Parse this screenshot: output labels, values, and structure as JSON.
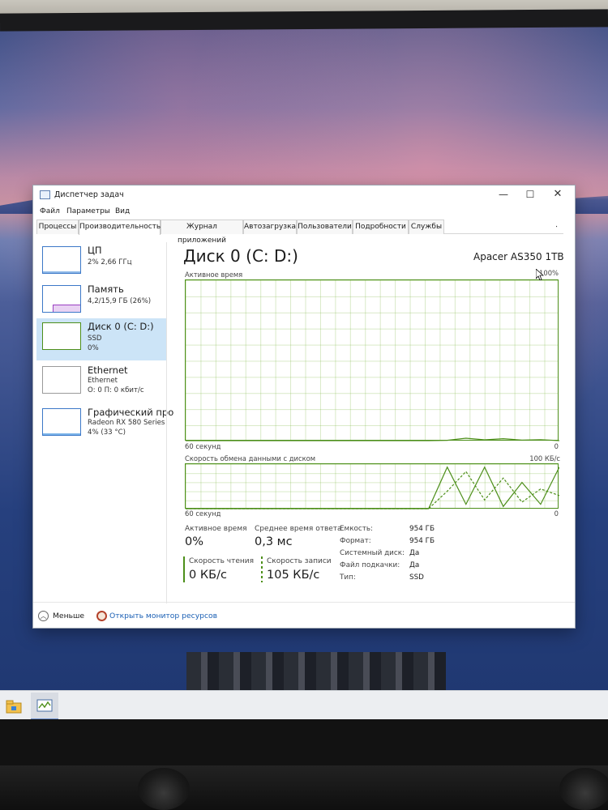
{
  "window": {
    "title": "Диспетчер задач",
    "controls": {
      "minimize": "—",
      "maximize": "☐",
      "close": "✕"
    }
  },
  "menu": [
    "Файл",
    "Параметры",
    "Вид"
  ],
  "tabs": [
    "Процессы",
    "Производительность",
    "Журнал приложений",
    "Автозагрузка",
    "Пользователи",
    "Подробности",
    "Службы"
  ],
  "active_tab": "Производительность",
  "sidebar": [
    {
      "name": "ЦП",
      "lines": [
        "2% 2,66 ГГц"
      ]
    },
    {
      "name": "Память",
      "lines": [
        "4,2/15,9 ГБ (26%)"
      ]
    },
    {
      "name": "Диск 0 (C: D:)",
      "lines": [
        "SSD",
        "0%"
      ],
      "active": true
    },
    {
      "name": "Ethernet",
      "lines": [
        "Ethernet",
        "О: 0 П: 0 кбит/с"
      ]
    },
    {
      "name": "Графический про",
      "lines": [
        "Radeon RX 580 Series",
        "4% (33 °C)"
      ]
    }
  ],
  "main": {
    "title": "Диск 0 (C: D:)",
    "model": "Apacer AS350 1TB",
    "active_graph": {
      "label": "Активное время",
      "max": "100%",
      "x_left": "60 секунд",
      "x_right": "0"
    },
    "rate_graph": {
      "label": "Скорость обмена данными с диском",
      "max": "100 КБ/с",
      "x_left": "60 секунд",
      "x_right": "0"
    },
    "stats": {
      "active_time_label": "Активное время",
      "active_time": "0%",
      "avg_response_label": "Среднее время ответа",
      "avg_response": "0,3 мс",
      "read_label": "Скорость чтения",
      "read": "0 КБ/с",
      "write_label": "Скорость записи",
      "write": "105 КБ/с"
    },
    "props": [
      {
        "k": "Емкость:",
        "v": "954 ГБ"
      },
      {
        "k": "Формат:",
        "v": "954 ГБ"
      },
      {
        "k": "Системный диск:",
        "v": "Да"
      },
      {
        "k": "Файл подкачки:",
        "v": "Да"
      },
      {
        "k": "Тип:",
        "v": "SSD"
      }
    ]
  },
  "footer": {
    "less": "Меньше",
    "resmon": "Открыть монитор ресурсов"
  },
  "colors": {
    "disk_green": "#4d8f1a",
    "grid_green": "#76b238",
    "selection": "#cce4f7",
    "link": "#1a5fb4"
  },
  "chart_data": [
    {
      "type": "line",
      "title": "Активное время",
      "xlabel": "60 секунд … 0",
      "ylim": [
        0,
        100
      ],
      "unit": "%",
      "x": [
        60,
        57,
        54,
        51,
        48,
        45,
        42,
        39,
        36,
        33,
        30,
        27,
        24,
        21,
        18,
        15,
        12,
        9,
        6,
        3,
        0
      ],
      "values": [
        0,
        0,
        0,
        0,
        0,
        0,
        0,
        0,
        0,
        0,
        0,
        0,
        0,
        0,
        0.2,
        1.5,
        0.5,
        1.2,
        0.3,
        0.6,
        0
      ]
    },
    {
      "type": "line",
      "title": "Скорость обмена данными с диском",
      "ylim": [
        0,
        100
      ],
      "unit": "КБ/с",
      "x": [
        60,
        57,
        54,
        51,
        48,
        45,
        42,
        39,
        36,
        33,
        30,
        27,
        24,
        21,
        18,
        15,
        12,
        9,
        6,
        3,
        0
      ],
      "series": [
        {
          "values": [
            0,
            0,
            0,
            0,
            0,
            0,
            0,
            0,
            0,
            0,
            0,
            0,
            0,
            0,
            95,
            10,
            95,
            5,
            60,
            10,
            95
          ]
        },
        {
          "values": [
            0,
            0,
            0,
            0,
            0,
            0,
            0,
            0,
            0,
            0,
            0,
            0,
            0,
            0,
            40,
            85,
            20,
            70,
            15,
            45,
            30
          ]
        }
      ]
    }
  ]
}
